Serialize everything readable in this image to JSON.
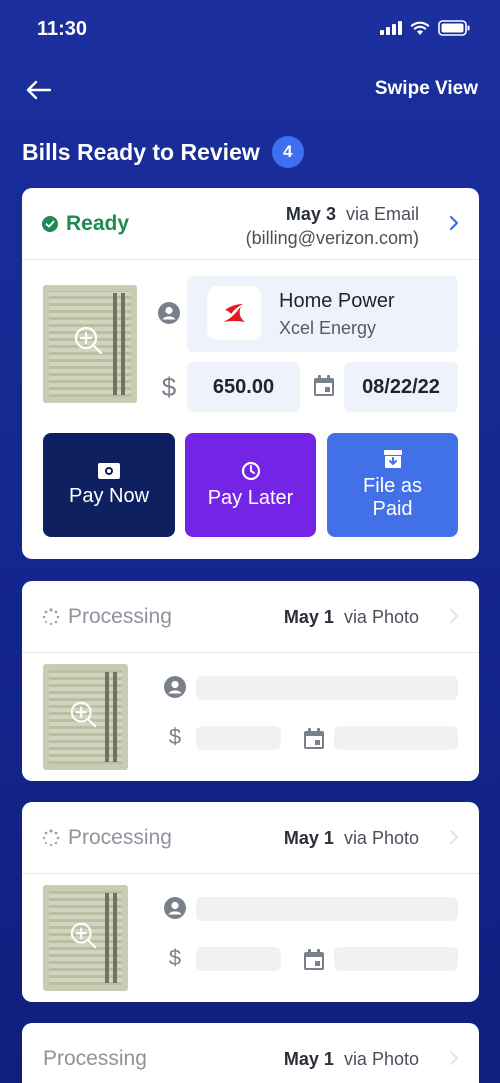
{
  "status_bar": {
    "time": "11:30"
  },
  "nav": {
    "swipe_view": "Swipe View"
  },
  "header": {
    "title": "Bills Ready to Review",
    "count": "4"
  },
  "ready_card": {
    "status": "Ready",
    "date": "May 3",
    "via": "via Email",
    "email": "(billing@verizon.com)",
    "payee_name": "Home Power",
    "payee_company": "Xcel Energy",
    "amount": "650.00",
    "due_date": "08/22/22",
    "pay_now": "Pay Now",
    "pay_later": "Pay Later",
    "file_paid_line1": "File as",
    "file_paid_line2": "Paid"
  },
  "processing_cards": [
    {
      "status": "Processing",
      "date": "May 1",
      "via": "via Photo"
    },
    {
      "status": "Processing",
      "date": "May 1",
      "via": "via Photo"
    },
    {
      "status": "Processing",
      "date": "May 1",
      "via": "via Photo"
    }
  ],
  "colors": {
    "background": "#14278f",
    "ready_green": "#1f8a55",
    "pay_now": "#0f2060",
    "pay_later": "#7424e5",
    "file_paid": "#4270e6",
    "badge": "#3f6ef0"
  }
}
